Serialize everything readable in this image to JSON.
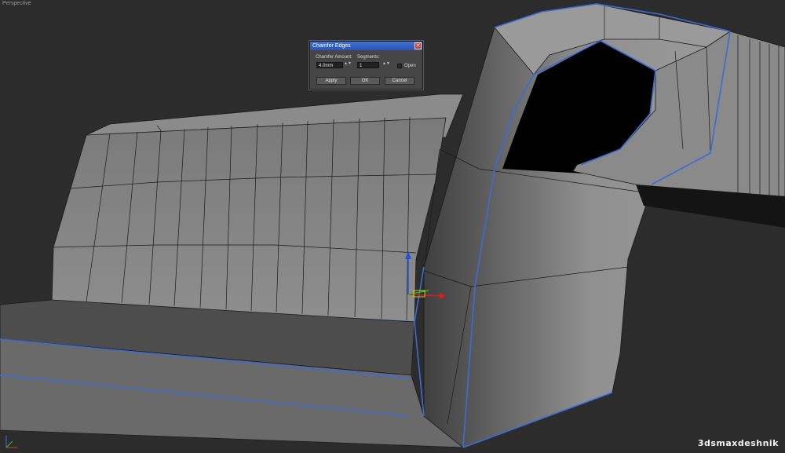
{
  "viewport": {
    "label": "Perspective"
  },
  "dialog": {
    "title": "Chamfer Edges",
    "close_glyph": "✕",
    "chamfer_amount_label": "Chamfer Amount:",
    "chamfer_amount_value": "4.0mm",
    "segments_label": "Segments:",
    "segments_value": "1",
    "spin_glyph": "▲▼",
    "open_label": "Open",
    "apply_label": "Apply",
    "ok_label": "OK",
    "cancel_label": "Cancel"
  },
  "watermark": "3dsmaxdeshnik",
  "colors": {
    "background": "#2c2c2c",
    "mesh_face": "#808080",
    "mesh_edge": "#1a1a1a",
    "selected_edge": "#3a6bd8"
  },
  "gizmo": {
    "icons": [
      "z-axis-arrow-icon",
      "x-axis-arrow-icon",
      "y-axis-arrow-icon"
    ]
  }
}
